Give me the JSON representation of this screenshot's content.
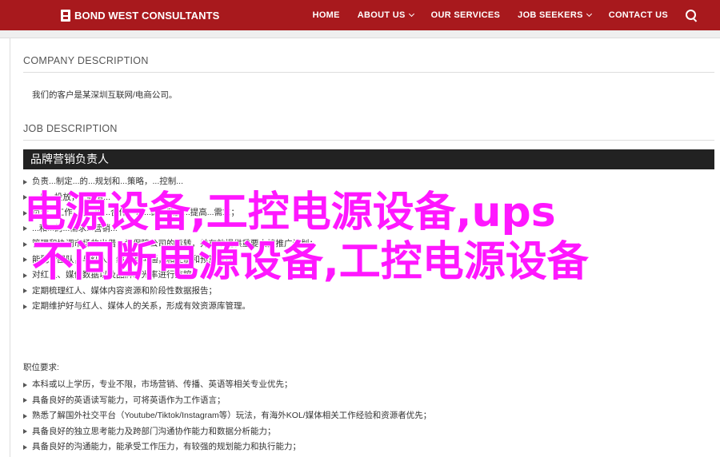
{
  "header": {
    "brand": "BOND WEST CONSULTANTS",
    "nav": [
      {
        "label": "HOME",
        "dropdown": false
      },
      {
        "label": "ABOUT US",
        "dropdown": true
      },
      {
        "label": "OUR SERVICES",
        "dropdown": false
      },
      {
        "label": "JOB SEEKERS",
        "dropdown": true
      },
      {
        "label": "CONTACT US",
        "dropdown": false
      }
    ],
    "search_icon": "search-icon",
    "accent_color": "#a8191d"
  },
  "company": {
    "title": "COMPANY DESCRIPTION",
    "text": "我们的客户是某深圳互联网/电商公司。"
  },
  "job": {
    "title": "JOB DESCRIPTION",
    "position": "品牌营销负责人",
    "duties": [
      "负责...制定...的...规划和...策略，...控制...",
      "...与...投放，...渠道...",
      "负责...工作...与...的...合作，以...的...数据...提高...需求；",
      "...和...的...需求...营销...",
      "管理和协调市场的出借，为保障公司的运转，并有效提供重要支持推广计划；",
      "能配合团队，与红人、编辑互沟通，和控制和预算管理；",
      "对红人、媒体数据以及品牌曝光率进行监控；",
      "定期梳理红人、媒体内容资源和阶段性数据报告；",
      "定期维护好与红人、媒体人的关系，形成有效资源库管理。"
    ],
    "requirements_label": "职位要求:",
    "requirements": [
      "本科或以上学历，专业不限，市场营销、传播、英语等相关专业优先；",
      "具备良好的英语读写能力，可将英语作为工作语言；",
      "熟悉了解国外社交平台（Youtube/Tiktok/Instagram等）玩法，有海外KOL/媒体相关工作经验和资源者优先；",
      "具备良好的独立思考能力及跨部门沟通协作能力和数据分析能力；",
      "具备良好的沟通能力，能承受工作压力，有较强的规划能力和执行能力；"
    ]
  },
  "overlay": {
    "line1": "电源设备,工控电源设备,ups",
    "line2": "不间断电源设备,工控电源设备",
    "color": "#ff17ff"
  }
}
